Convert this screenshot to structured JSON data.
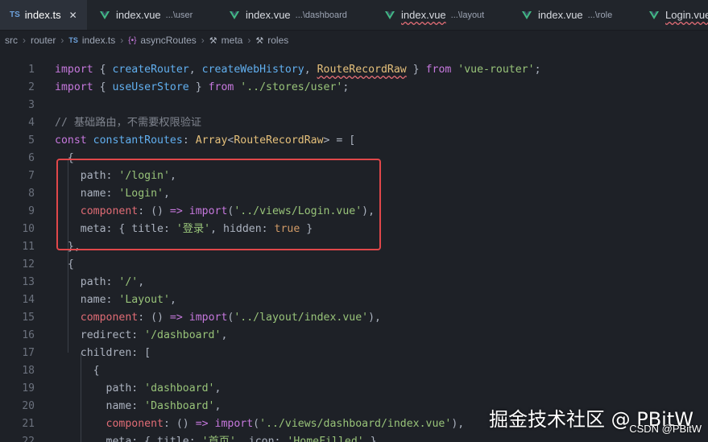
{
  "tabs": [
    {
      "kind": "ts",
      "badge": "TS",
      "name": "index.ts",
      "dir": "",
      "active": true,
      "close": "✕"
    },
    {
      "kind": "vue",
      "name": "index.vue",
      "dir": "...\\user",
      "active": false
    },
    {
      "kind": "vue",
      "name": "index.vue",
      "dir": "...\\dashboard",
      "active": false
    },
    {
      "kind": "vue",
      "name": "index.vue",
      "dir": "...\\layout",
      "active": false,
      "err": true
    },
    {
      "kind": "vue",
      "name": "index.vue",
      "dir": "...\\role",
      "active": false
    },
    {
      "kind": "vue",
      "name": "Login.vue",
      "dir": "",
      "active": false,
      "err": true
    }
  ],
  "breadcrumb": {
    "src": "src",
    "router": "router",
    "file_badge": "TS",
    "file": "index.ts",
    "symbol": "asyncRoutes",
    "meta": "meta",
    "roles": "roles",
    "sep": "›"
  },
  "code_lines": [
    {
      "n": "1",
      "tokens": [
        [
          "k",
          "import"
        ],
        [
          "plain",
          " { "
        ],
        [
          "f",
          "createRouter"
        ],
        [
          "plain",
          ", "
        ],
        [
          "f",
          "createWebHistory"
        ],
        [
          "plain",
          ", "
        ],
        [
          "v wavy",
          "RouteRecordRaw"
        ],
        [
          "plain",
          " } "
        ],
        [
          "k",
          "from"
        ],
        [
          "plain",
          " "
        ],
        [
          "s",
          "'vue-router'"
        ],
        [
          "plain",
          ";"
        ]
      ]
    },
    {
      "n": "2",
      "tokens": [
        [
          "k",
          "import"
        ],
        [
          "plain",
          " { "
        ],
        [
          "f",
          "useUserStore"
        ],
        [
          "plain",
          " } "
        ],
        [
          "k",
          "from"
        ],
        [
          "plain",
          " "
        ],
        [
          "s",
          "'../stores/user'"
        ],
        [
          "plain",
          ";"
        ]
      ]
    },
    {
      "n": "3",
      "tokens": []
    },
    {
      "n": "4",
      "tokens": [
        [
          "c",
          "// 基础路由，不需要权限验证"
        ]
      ]
    },
    {
      "n": "5",
      "tokens": [
        [
          "k",
          "const"
        ],
        [
          "plain",
          " "
        ],
        [
          "f",
          "constantRoutes"
        ],
        [
          "plain",
          ": "
        ],
        [
          "v",
          "Array"
        ],
        [
          "plain",
          "<"
        ],
        [
          "v",
          "RouteRecordRaw"
        ],
        [
          "plain",
          "> = ["
        ]
      ]
    },
    {
      "n": "6",
      "tokens": [
        [
          "plain",
          "  {"
        ]
      ]
    },
    {
      "n": "7",
      "tokens": [
        [
          "plain",
          "    path: "
        ],
        [
          "s",
          "'/login'"
        ],
        [
          "plain",
          ","
        ]
      ]
    },
    {
      "n": "8",
      "tokens": [
        [
          "plain",
          "    name: "
        ],
        [
          "s",
          "'Login'"
        ],
        [
          "plain",
          ","
        ]
      ]
    },
    {
      "n": "9",
      "tokens": [
        [
          "pr",
          "    component"
        ],
        [
          "plain",
          ": () "
        ],
        [
          "k",
          "=>"
        ],
        [
          "plain",
          " "
        ],
        [
          "k",
          "import"
        ],
        [
          "plain",
          "("
        ],
        [
          "s",
          "'../views/Login.vue'"
        ],
        [
          "plain",
          "),"
        ]
      ]
    },
    {
      "n": "10",
      "tokens": [
        [
          "plain",
          "    meta: { title: "
        ],
        [
          "s",
          "'登录'"
        ],
        [
          "plain",
          ", hidden: "
        ],
        [
          "o",
          "true"
        ],
        [
          "plain",
          " }"
        ]
      ]
    },
    {
      "n": "11",
      "tokens": [
        [
          "plain",
          "  },"
        ]
      ]
    },
    {
      "n": "12",
      "tokens": [
        [
          "plain",
          "  {"
        ]
      ]
    },
    {
      "n": "13",
      "tokens": [
        [
          "plain",
          "    path: "
        ],
        [
          "s",
          "'/'"
        ],
        [
          "plain",
          ","
        ]
      ]
    },
    {
      "n": "14",
      "tokens": [
        [
          "plain",
          "    name: "
        ],
        [
          "s",
          "'Layout'"
        ],
        [
          "plain",
          ","
        ]
      ]
    },
    {
      "n": "15",
      "tokens": [
        [
          "pr",
          "    component"
        ],
        [
          "plain",
          ": () "
        ],
        [
          "k",
          "=>"
        ],
        [
          "plain",
          " "
        ],
        [
          "k",
          "import"
        ],
        [
          "plain",
          "("
        ],
        [
          "s",
          "'../layout/index.vue'"
        ],
        [
          "plain",
          "),"
        ]
      ]
    },
    {
      "n": "16",
      "tokens": [
        [
          "plain",
          "    redirect: "
        ],
        [
          "s",
          "'/dashboard'"
        ],
        [
          "plain",
          ","
        ]
      ]
    },
    {
      "n": "17",
      "tokens": [
        [
          "plain",
          "    children: ["
        ]
      ]
    },
    {
      "n": "18",
      "tokens": [
        [
          "plain",
          "      {"
        ]
      ]
    },
    {
      "n": "19",
      "tokens": [
        [
          "plain",
          "        path: "
        ],
        [
          "s",
          "'dashboard'"
        ],
        [
          "plain",
          ","
        ]
      ]
    },
    {
      "n": "20",
      "tokens": [
        [
          "plain",
          "        name: "
        ],
        [
          "s",
          "'Dashboard'"
        ],
        [
          "plain",
          ","
        ]
      ]
    },
    {
      "n": "21",
      "tokens": [
        [
          "pr",
          "        component"
        ],
        [
          "plain",
          ": () "
        ],
        [
          "k",
          "=>"
        ],
        [
          "plain",
          " "
        ],
        [
          "k",
          "import"
        ],
        [
          "plain",
          "("
        ],
        [
          "s",
          "'../views/dashboard/index.vue'"
        ],
        [
          "plain",
          "),"
        ]
      ]
    },
    {
      "n": "22",
      "tokens": [
        [
          "plain",
          "        meta: { title: "
        ],
        [
          "s",
          "'首页'"
        ],
        [
          "plain",
          ", icon: "
        ],
        [
          "s",
          "'HomeFilled'"
        ],
        [
          "plain",
          " },"
        ]
      ]
    }
  ],
  "watermark": "掘金技术社区 @ PBitW",
  "credit": "CSDN @PBitW",
  "colors": {
    "background": "#1e2127",
    "keyword": "#c678dd",
    "function": "#61afef",
    "string": "#98c379",
    "comment": "#7f848e",
    "type": "#e5c07b",
    "highlight_box": "#e0474a",
    "vue_icon": "#42b883"
  },
  "icons": {
    "vue": "vue-logo-icon",
    "symbol": "braces-icon",
    "wrench": "wrench-icon",
    "close": "close-icon"
  }
}
